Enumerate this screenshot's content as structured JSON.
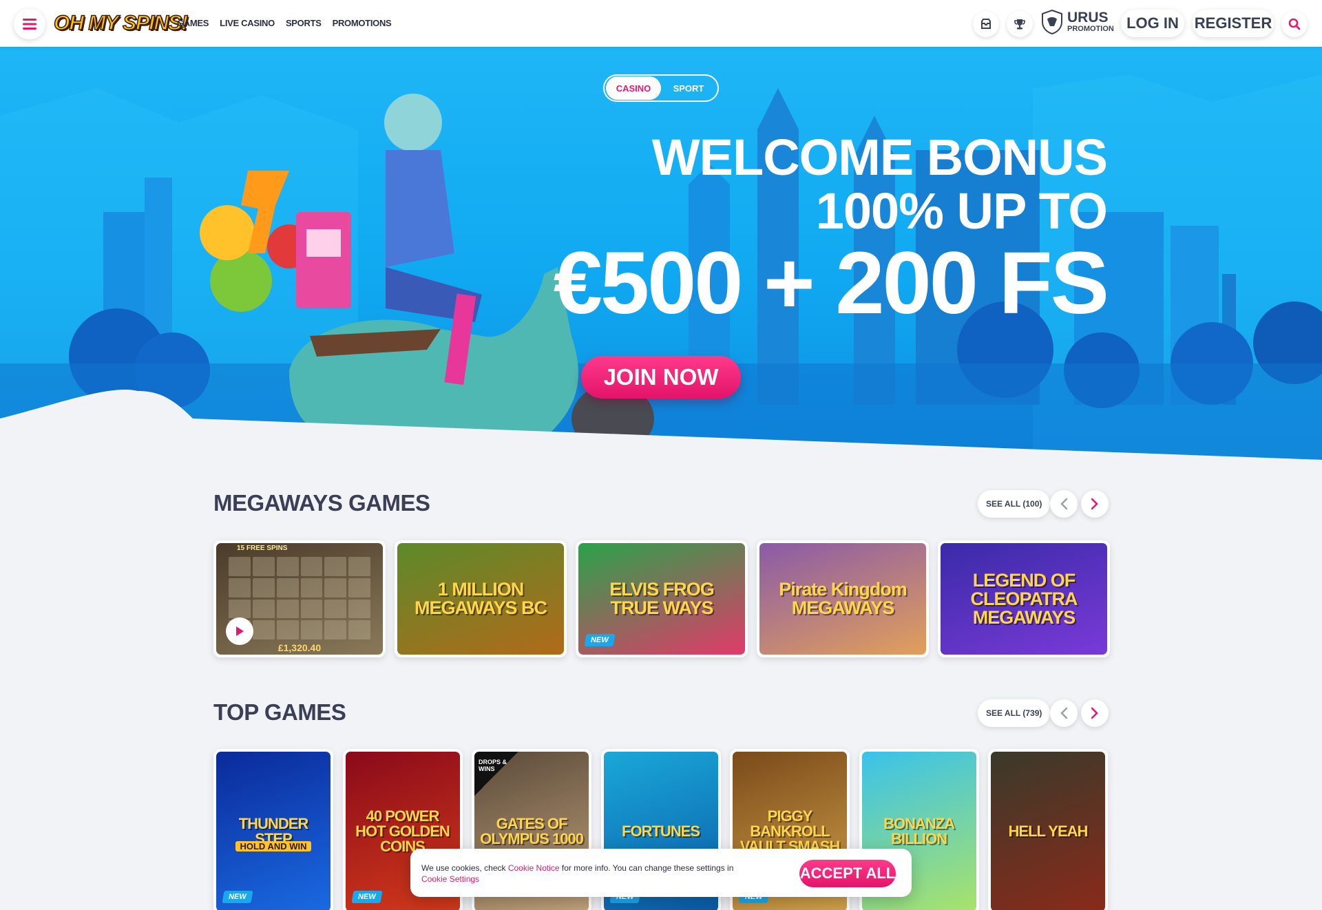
{
  "header": {
    "logo_text": "OH MY SPINS!",
    "nav": [
      "GAMES",
      "LIVE CASINO",
      "SPORTS",
      "PROMOTIONS"
    ],
    "urus_title": "URUS",
    "urus_sub": "PROMOTION",
    "login_label": "LOG IN",
    "register_label": "REGISTER",
    "icons": [
      "menu-icon",
      "inbox-icon",
      "trophy-icon",
      "search-icon"
    ]
  },
  "hero": {
    "toggle": [
      "CASINO",
      "SPORT"
    ],
    "active_toggle": "CASINO",
    "line1": "WELCOME BONUS",
    "line2": "100% UP TO",
    "amount": "€500 + 200 FS",
    "cta": "JOIN NOW"
  },
  "megaways": {
    "title": "MEGAWAYS GAMES",
    "see_all": "SEE ALL (100)",
    "games": [
      {
        "title": "",
        "win": "£1,320.40",
        "banner": "15 FREE SPINS",
        "colors": [
          "#4a3a2a",
          "#8a7a5a"
        ]
      },
      {
        "title": "1 MILLION MEGAWAYS BC",
        "colors": [
          "#5c8a2a",
          "#b26a1a"
        ]
      },
      {
        "title": "ELVIS FROG TRUE WAYS",
        "badge": "NEW",
        "colors": [
          "#2aa24a",
          "#e23a6a"
        ]
      },
      {
        "title": "Pirate Kingdom MEGAWAYS",
        "colors": [
          "#8a5aa8",
          "#e2a05a"
        ]
      },
      {
        "title": "LEGEND OF CLEOPATRA MEGAWAYS",
        "colors": [
          "#3a2aa8",
          "#7a3ad8"
        ]
      }
    ]
  },
  "top_games": {
    "title": "TOP GAMES",
    "see_all": "SEE ALL (739)",
    "games": [
      {
        "title": "THUNDER STEP",
        "sub": "HOLD AND WIN",
        "badge": "NEW",
        "colors": [
          "#0a2a9a",
          "#1a6ae2"
        ]
      },
      {
        "title": "40 POWER HOT GOLDEN COINS",
        "badge": "NEW",
        "colors": [
          "#8a0a1a",
          "#d23a1a"
        ]
      },
      {
        "title": "GATES OF OLYMPUS 1000",
        "ribbon": "DROPS & WINS",
        "colors": [
          "#5a4a3a",
          "#c2a27a"
        ]
      },
      {
        "title": "FORTUNES",
        "badge": "NEW",
        "colors": [
          "#1aa8d8",
          "#0a5aa8"
        ]
      },
      {
        "title": "PIGGY BANKROLL VAULT SMASH",
        "badge": "NEW",
        "colors": [
          "#7a4a1a",
          "#d2a24a"
        ]
      },
      {
        "title": "BONANZA BILLION",
        "colors": [
          "#3ac2ea",
          "#aae26a"
        ]
      },
      {
        "title": "HELL YEAH",
        "colors": [
          "#3a3a2a",
          "#8a2a1a"
        ]
      }
    ]
  },
  "cookie": {
    "text_before": "We use cookies, check ",
    "link1": "Cookie Notice",
    "text_after": " for more info. You can change these settings in ",
    "link2": "Cookie Settings",
    "accept": "ACCEPT ALL"
  },
  "colors": {
    "accent": "#e8176e",
    "sky": "#14acf3",
    "text": "#3b3f55"
  }
}
